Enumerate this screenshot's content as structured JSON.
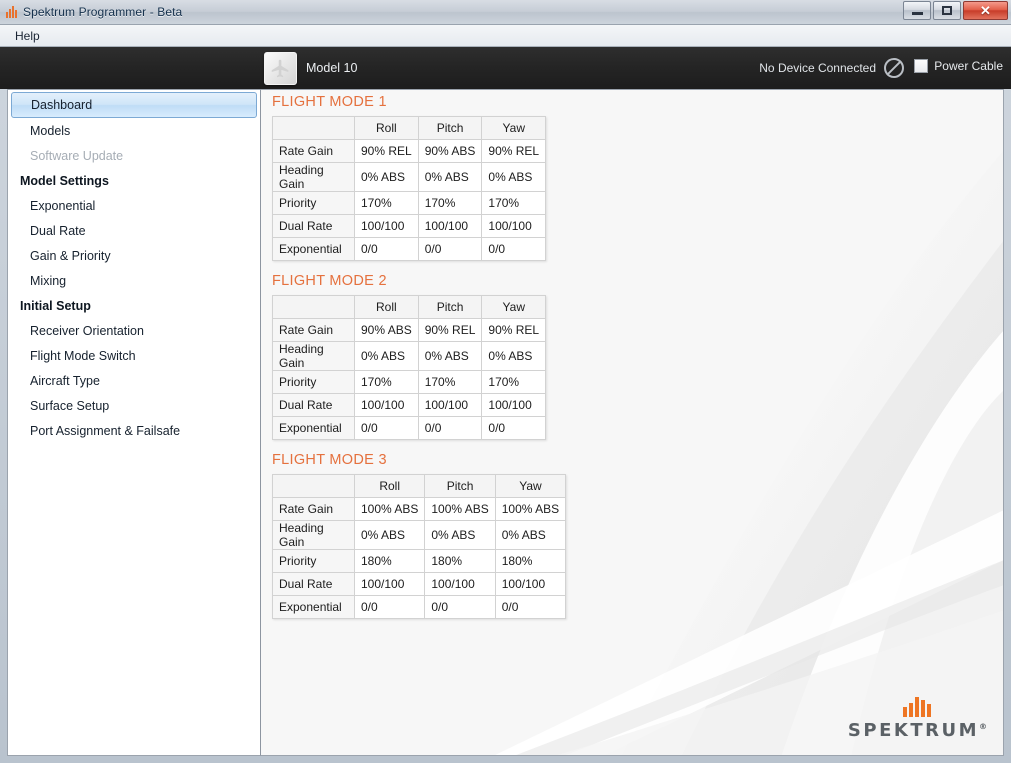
{
  "window": {
    "title": "Spektrum Programmer - Beta",
    "minimize_label": "Minimize",
    "maximize_label": "Maximize",
    "close_label": "✕"
  },
  "menubar": {
    "items": [
      {
        "label": "Help"
      }
    ]
  },
  "header": {
    "model_name": "Model 10",
    "model_icon": "airplane-icon",
    "device_status": "No Device Connected",
    "status_icon": "no-entry-icon",
    "power_cable_label": "Power Cable",
    "power_cable_checked": false
  },
  "sidebar": {
    "items": [
      {
        "label": "Dashboard",
        "state": "selected"
      },
      {
        "label": "Models",
        "state": "normal"
      },
      {
        "label": "Software Update",
        "state": "disabled"
      },
      {
        "label": "Model Settings",
        "state": "group"
      },
      {
        "label": "Exponential",
        "state": "normal"
      },
      {
        "label": "Dual Rate",
        "state": "normal"
      },
      {
        "label": "Gain & Priority",
        "state": "normal"
      },
      {
        "label": "Mixing",
        "state": "normal"
      },
      {
        "label": "Initial Setup",
        "state": "group"
      },
      {
        "label": "Receiver Orientation",
        "state": "normal"
      },
      {
        "label": "Flight Mode Switch",
        "state": "normal"
      },
      {
        "label": "Aircraft Type",
        "state": "normal"
      },
      {
        "label": "Surface Setup",
        "state": "normal"
      },
      {
        "label": "Port Assignment & Failsafe",
        "state": "normal"
      }
    ]
  },
  "colors": {
    "accent_orange": "#e5713e",
    "brand_orange": "#ee7523",
    "selection_blue": "#bfdcf6",
    "dark_header": "#242424"
  },
  "main": {
    "columns": [
      "",
      "Roll",
      "Pitch",
      "Yaw"
    ],
    "row_labels": [
      "Rate Gain",
      "Heading Gain",
      "Priority",
      "Dual Rate",
      "Exponential"
    ],
    "flight_modes": [
      {
        "title": "FLIGHT MODE 1",
        "rows": [
          {
            "label": "Rate Gain",
            "roll": "90% REL",
            "pitch": "90% ABS",
            "yaw": "90% REL"
          },
          {
            "label": "Heading Gain",
            "roll": "0% ABS",
            "pitch": "0% ABS",
            "yaw": "0% ABS"
          },
          {
            "label": "Priority",
            "roll": "170%",
            "pitch": "170%",
            "yaw": "170%"
          },
          {
            "label": "Dual Rate",
            "roll": "100/100",
            "pitch": "100/100",
            "yaw": "100/100"
          },
          {
            "label": "Exponential",
            "roll": "0/0",
            "pitch": "0/0",
            "yaw": "0/0"
          }
        ]
      },
      {
        "title": "FLIGHT MODE 2",
        "rows": [
          {
            "label": "Rate Gain",
            "roll": "90% ABS",
            "pitch": "90% REL",
            "yaw": "90% REL"
          },
          {
            "label": "Heading Gain",
            "roll": "0% ABS",
            "pitch": "0% ABS",
            "yaw": "0% ABS"
          },
          {
            "label": "Priority",
            "roll": "170%",
            "pitch": "170%",
            "yaw": "170%"
          },
          {
            "label": "Dual Rate",
            "roll": "100/100",
            "pitch": "100/100",
            "yaw": "100/100"
          },
          {
            "label": "Exponential",
            "roll": "0/0",
            "pitch": "0/0",
            "yaw": "0/0"
          }
        ]
      },
      {
        "title": "FLIGHT MODE 3",
        "rows": [
          {
            "label": "Rate Gain",
            "roll": "100% ABS",
            "pitch": "100% ABS",
            "yaw": "100% ABS"
          },
          {
            "label": "Heading Gain",
            "roll": "0% ABS",
            "pitch": "0% ABS",
            "yaw": "0% ABS"
          },
          {
            "label": "Priority",
            "roll": "180%",
            "pitch": "180%",
            "yaw": "180%"
          },
          {
            "label": "Dual Rate",
            "roll": "100/100",
            "pitch": "100/100",
            "yaw": "100/100"
          },
          {
            "label": "Exponential",
            "roll": "0/0",
            "pitch": "0/0",
            "yaw": "0/0"
          }
        ]
      }
    ]
  },
  "brand": {
    "word": "SPEKTRUM",
    "trademark": "®"
  }
}
